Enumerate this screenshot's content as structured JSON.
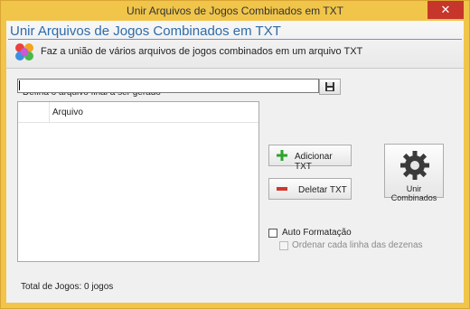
{
  "window": {
    "title": "Unir Arquivos de Jogos Combinados em TXT",
    "close_glyph": "✕"
  },
  "header": {
    "title": "Unir Arquivos de Jogos Combinados em TXT",
    "description": "Faz a união de vários arquivos de jogos combinados em um arquivo TXT"
  },
  "output_file": {
    "label": "Defina o arquivo final a ser gerado",
    "value": ""
  },
  "list": {
    "columns": [
      "",
      "Arquivo"
    ],
    "rows": []
  },
  "buttons": {
    "add": "Adicionar TXT",
    "delete": "Deletar TXT",
    "merge": "Unir Combinados"
  },
  "options": {
    "auto_format": {
      "label": "Auto Formatação",
      "checked": false
    },
    "order_lines": {
      "label": "Ordenar cada linha das dezenas",
      "checked": false,
      "enabled": false
    }
  },
  "footer": {
    "total": "Total de Jogos: 0 jogos"
  },
  "icons": {
    "header": "lottery-balls-icon",
    "save": "floppy-disk-icon",
    "add": "plus-icon",
    "delete": "minus-icon",
    "merge": "gear-icon"
  },
  "colors": {
    "title_blue": "#2d6ba9",
    "window_frame": "#f0c54a",
    "close_red": "#c7362a",
    "add_green": "#2aa52a",
    "delete_red": "#d2352d"
  }
}
